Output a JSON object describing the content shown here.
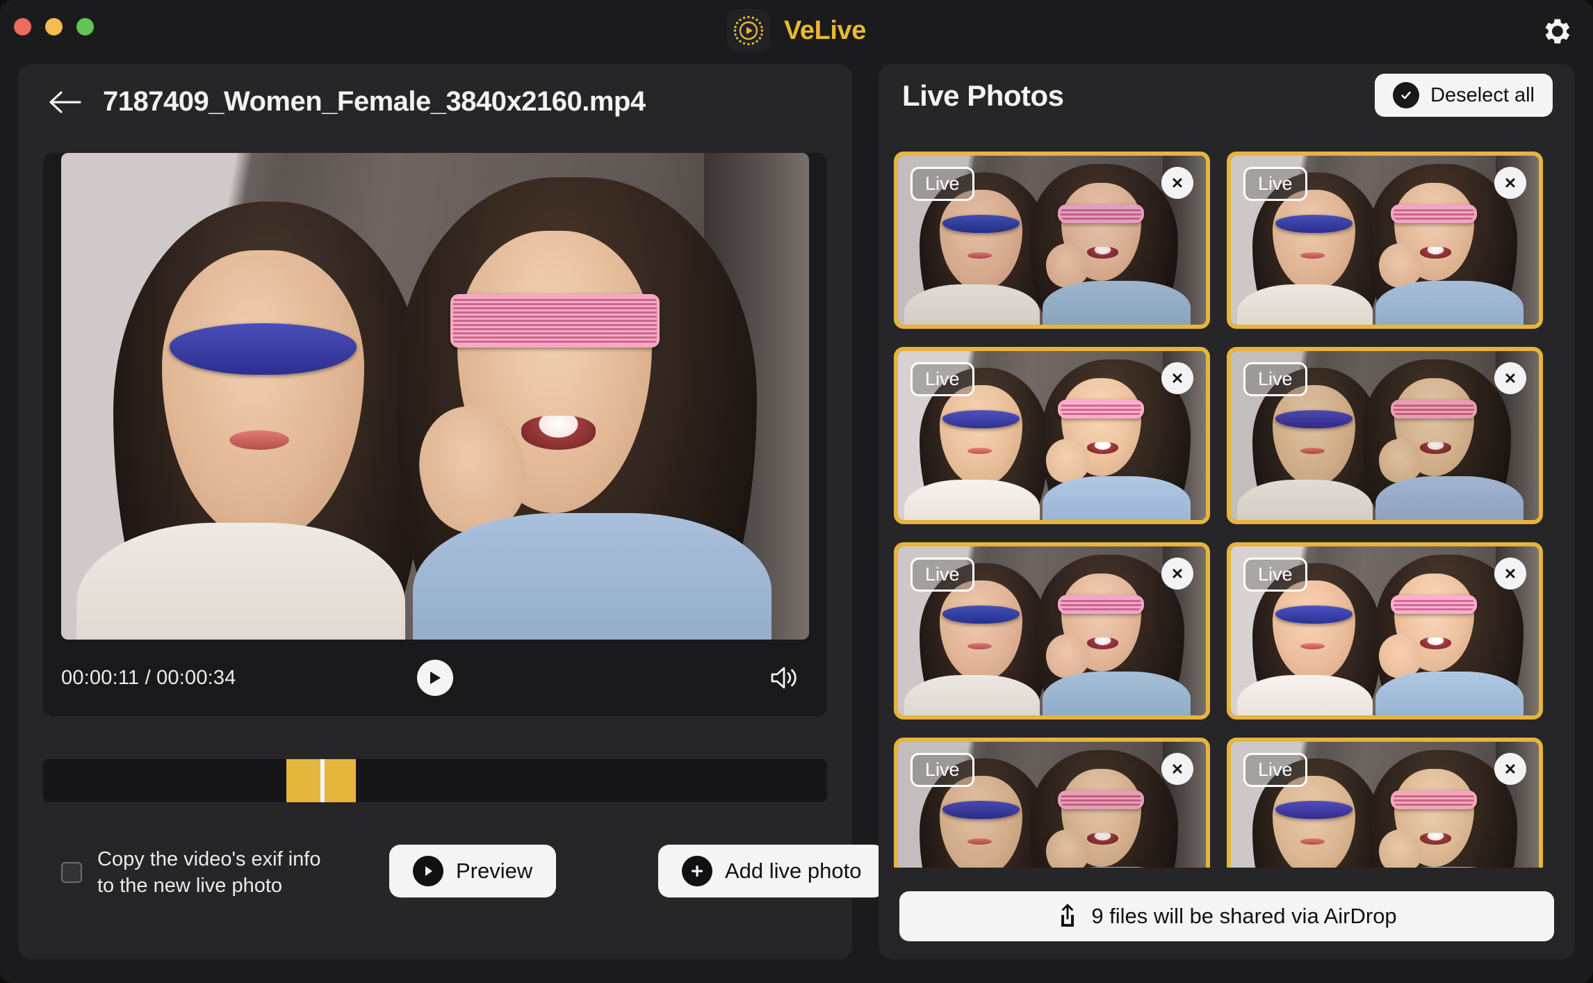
{
  "window": {
    "traffic_lights": [
      "close",
      "minimize",
      "zoom"
    ],
    "app_name": "VeLive",
    "logo_icon": "play-circle-dotted-icon",
    "settings_icon": "gear-icon",
    "accent_color": "#e5b53c",
    "panel_bg": "#262628",
    "window_bg": "#1b1b1d"
  },
  "left_panel": {
    "back_icon": "arrow-left-icon",
    "file_name": "7187409_Women_Female_3840x2160.mp4",
    "player": {
      "current_time": "00:00:11",
      "separator": "/",
      "duration": "00:00:34",
      "time_display": "00:00:11  / 00:00:34",
      "play_icon": "play-icon",
      "volume_icon": "speaker-wave-icon"
    },
    "timeline": {
      "selection_start_pct": 31.0,
      "selection_width_pct": 8.9,
      "playhead_pct": 35.4,
      "selection_color": "#e5b53c",
      "playhead_color": "#f5f5f5",
      "track_color": "#161618"
    },
    "exif_checkbox": {
      "label": "Copy the video's exif info to the new live photo",
      "checked": false
    },
    "preview_button": {
      "label": "Preview",
      "icon": "play-icon"
    },
    "add_live_photo_button": {
      "label": "Add live photo",
      "icon": "plus-icon"
    }
  },
  "right_panel": {
    "title": "Live Photos",
    "deselect_all_button": {
      "label": "Deselect all",
      "icon": "check-circle-icon"
    },
    "thumbnails": [
      {
        "badge": "Live",
        "selected": true,
        "close_icon": "close-icon"
      },
      {
        "badge": "Live",
        "selected": true,
        "close_icon": "close-icon"
      },
      {
        "badge": "Live",
        "selected": true,
        "close_icon": "close-icon"
      },
      {
        "badge": "Live",
        "selected": true,
        "close_icon": "close-icon"
      },
      {
        "badge": "Live",
        "selected": true,
        "close_icon": "close-icon"
      },
      {
        "badge": "Live",
        "selected": true,
        "close_icon": "close-icon"
      },
      {
        "badge": "Live",
        "selected": true,
        "close_icon": "close-icon"
      },
      {
        "badge": "Live",
        "selected": true,
        "close_icon": "close-icon"
      }
    ],
    "airdrop_bar": {
      "label": "9 files will be shared via AirDrop",
      "icon": "share-upload-icon",
      "file_count": 9
    }
  }
}
